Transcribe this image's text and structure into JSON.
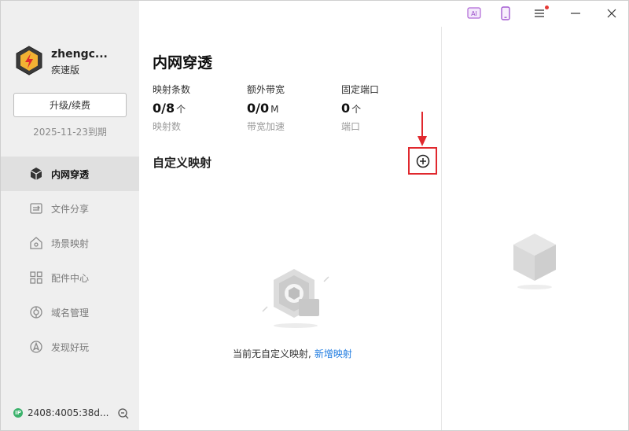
{
  "user": {
    "name": "zhengc...",
    "edition": "疾速版",
    "upgrade_label": "升级/续费",
    "expire_date": "2025-11-23到期"
  },
  "nav": {
    "items": [
      {
        "label": "内网穿透",
        "icon": "cube-icon",
        "active": true
      },
      {
        "label": "文件分享",
        "icon": "file-share-icon",
        "active": false
      },
      {
        "label": "场景映射",
        "icon": "scene-map-icon",
        "active": false
      },
      {
        "label": "配件中心",
        "icon": "grid-icon",
        "active": false
      },
      {
        "label": "域名管理",
        "icon": "domain-icon",
        "active": false
      },
      {
        "label": "发现好玩",
        "icon": "compass-icon",
        "active": false
      }
    ]
  },
  "status": {
    "ip_badge": "IP",
    "ip": "2408:4005:38d..."
  },
  "titlebar": {
    "ai_label": "AI"
  },
  "main": {
    "title": "内网穿透",
    "stats": [
      {
        "label": "映射条数",
        "value": "0/8",
        "unit": "个",
        "sub": "映射数"
      },
      {
        "label": "额外带宽",
        "value": "0/0",
        "unit": "M",
        "sub": "带宽加速"
      },
      {
        "label": "固定端口",
        "value": "0",
        "unit": "个",
        "sub": "端口"
      }
    ],
    "section_title": "自定义映射",
    "empty_text": "当前无自定义映射,",
    "empty_link": "新增映射"
  },
  "colors": {
    "accent_link": "#1e7be0",
    "highlight_red": "#e0282e",
    "sidebar_bg": "#efefef",
    "active_item_bg": "#e0e0e0",
    "ip_green": "#3bb26b"
  }
}
